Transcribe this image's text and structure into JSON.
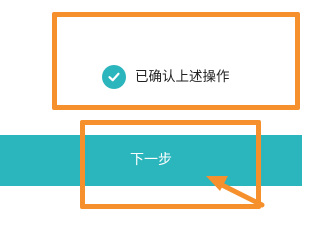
{
  "confirm": {
    "label": "已确认上述操作",
    "checked": true,
    "icon": "check-circle-icon"
  },
  "next_button": {
    "label": "下一步"
  },
  "colors": {
    "accent": "#2bb5bc",
    "annotation": "#f5902c",
    "text": "#222222",
    "button_text": "#ffffff"
  }
}
